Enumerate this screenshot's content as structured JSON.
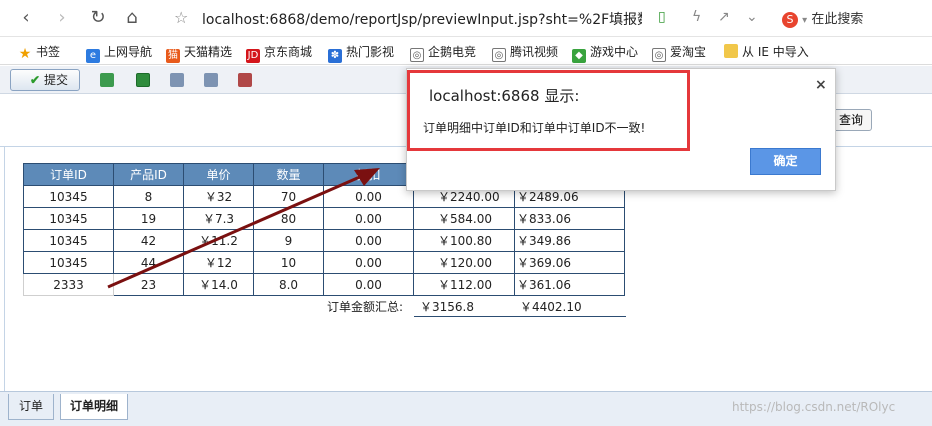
{
  "browser": {
    "url": "localhost:6868/demo/reportJsp/previewInput.jsp?sht=%2F填报数",
    "search_placeholder": "在此搜索",
    "bookmarks": [
      "书签",
      "上网导航",
      "天猫精选",
      "京东商城",
      "热门影视",
      "企鹅电竞",
      "腾讯视频",
      "游戏中心",
      "爱淘宝",
      "从 IE 中导入"
    ]
  },
  "toolbar": {
    "submit_label": "提交",
    "query_label": "查询"
  },
  "table": {
    "headers": [
      "订单ID",
      "产品ID",
      "单价",
      "数量",
      "折扣",
      "",
      ""
    ],
    "rows": [
      [
        "10345",
        "8",
        "￥32",
        "70",
        "0.00",
        "￥2240.00",
        "￥2489.06"
      ],
      [
        "10345",
        "19",
        "￥7.3",
        "80",
        "0.00",
        "￥584.00",
        "￥833.06"
      ],
      [
        "10345",
        "42",
        "￥11.2",
        "9",
        "0.00",
        "￥100.80",
        "￥349.86"
      ],
      [
        "10345",
        "44",
        "￥12",
        "10",
        "0.00",
        "￥120.00",
        "￥369.06"
      ],
      [
        "2333",
        "23",
        "￥14.0",
        "8.0",
        "0.00",
        "￥112.00",
        "￥361.06"
      ]
    ],
    "total_label": "订单金额汇总:",
    "total_1": "￥3156.8",
    "total_2": "￥4402.10"
  },
  "tabs": [
    {
      "label": "订单"
    },
    {
      "label": "订单明细"
    }
  ],
  "dialog": {
    "title": "localhost:6868 显示:",
    "message": "订单明细中订单ID和订单中订单ID不一致!",
    "ok_label": "确定",
    "close_glyph": "×"
  },
  "watermark": "https://blog.csdn.net/ROlyc",
  "colors": {
    "header": "#5d8ab8",
    "border": "#2c4d72",
    "arrow": "#7a1010",
    "highlight": "#e5383b",
    "ok": "#5b96e6"
  }
}
